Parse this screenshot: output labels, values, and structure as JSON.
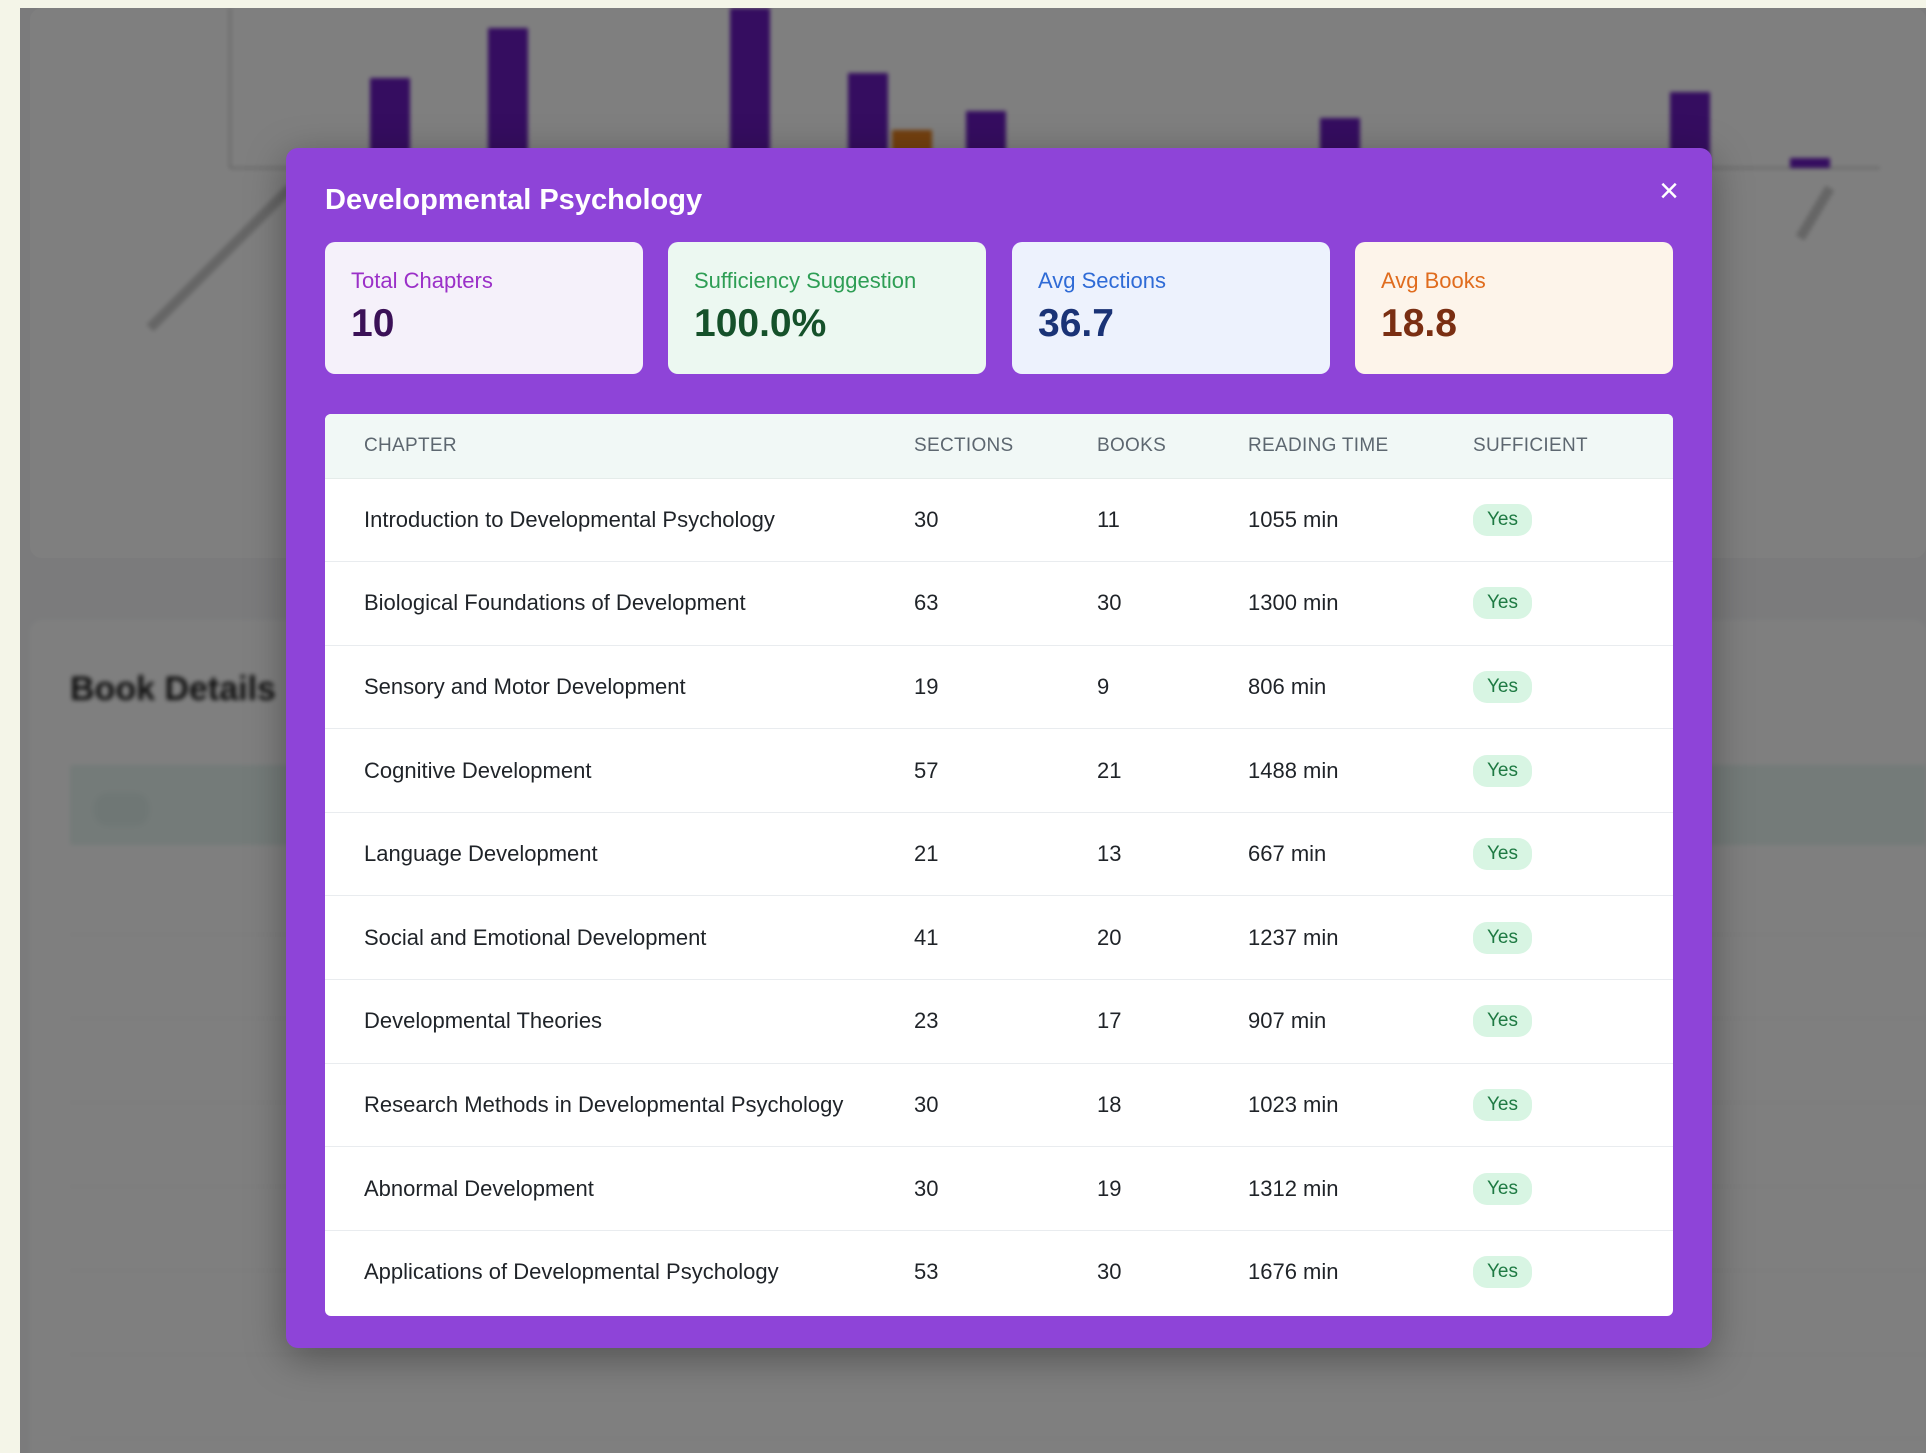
{
  "modal": {
    "title": "Developmental Psychology",
    "close_icon": "close-icon"
  },
  "stats": [
    {
      "label": "Total Chapters",
      "value": "10"
    },
    {
      "label": "Sufficiency Suggestion",
      "value": "100.0%"
    },
    {
      "label": "Avg Sections",
      "value": "36.7"
    },
    {
      "label": "Avg Books",
      "value": "18.8"
    }
  ],
  "table": {
    "headers": [
      "CHAPTER",
      "SECTIONS",
      "BOOKS",
      "READING TIME",
      "SUFFICIENT"
    ],
    "rows": [
      {
        "chapter": "Introduction to Developmental Psychology",
        "sections": "30",
        "books": "11",
        "reading_time": "1055 min",
        "sufficient": "Yes"
      },
      {
        "chapter": "Biological Foundations of Development",
        "sections": "63",
        "books": "30",
        "reading_time": "1300 min",
        "sufficient": "Yes"
      },
      {
        "chapter": "Sensory and Motor Development",
        "sections": "19",
        "books": "9",
        "reading_time": "806 min",
        "sufficient": "Yes"
      },
      {
        "chapter": "Cognitive Development",
        "sections": "57",
        "books": "21",
        "reading_time": "1488 min",
        "sufficient": "Yes"
      },
      {
        "chapter": "Language Development",
        "sections": "21",
        "books": "13",
        "reading_time": "667 min",
        "sufficient": "Yes"
      },
      {
        "chapter": "Social and Emotional Development",
        "sections": "41",
        "books": "20",
        "reading_time": "1237 min",
        "sufficient": "Yes"
      },
      {
        "chapter": "Developmental Theories",
        "sections": "23",
        "books": "17",
        "reading_time": "907 min",
        "sufficient": "Yes"
      },
      {
        "chapter": "Research Methods in Developmental Psychology",
        "sections": "30",
        "books": "18",
        "reading_time": "1023 min",
        "sufficient": "Yes"
      },
      {
        "chapter": "Abnormal Development",
        "sections": "30",
        "books": "19",
        "reading_time": "1312 min",
        "sufficient": "Yes"
      },
      {
        "chapter": "Applications of Developmental Psychology",
        "sections": "53",
        "books": "30",
        "reading_time": "1676 min",
        "sufficient": "Yes"
      }
    ]
  },
  "background": {
    "details_title": "Book Details"
  },
  "colors": {
    "modal_bg": "#8e44d8",
    "badge_bg": "#d8f5e3",
    "badge_text": "#1e7a43"
  }
}
